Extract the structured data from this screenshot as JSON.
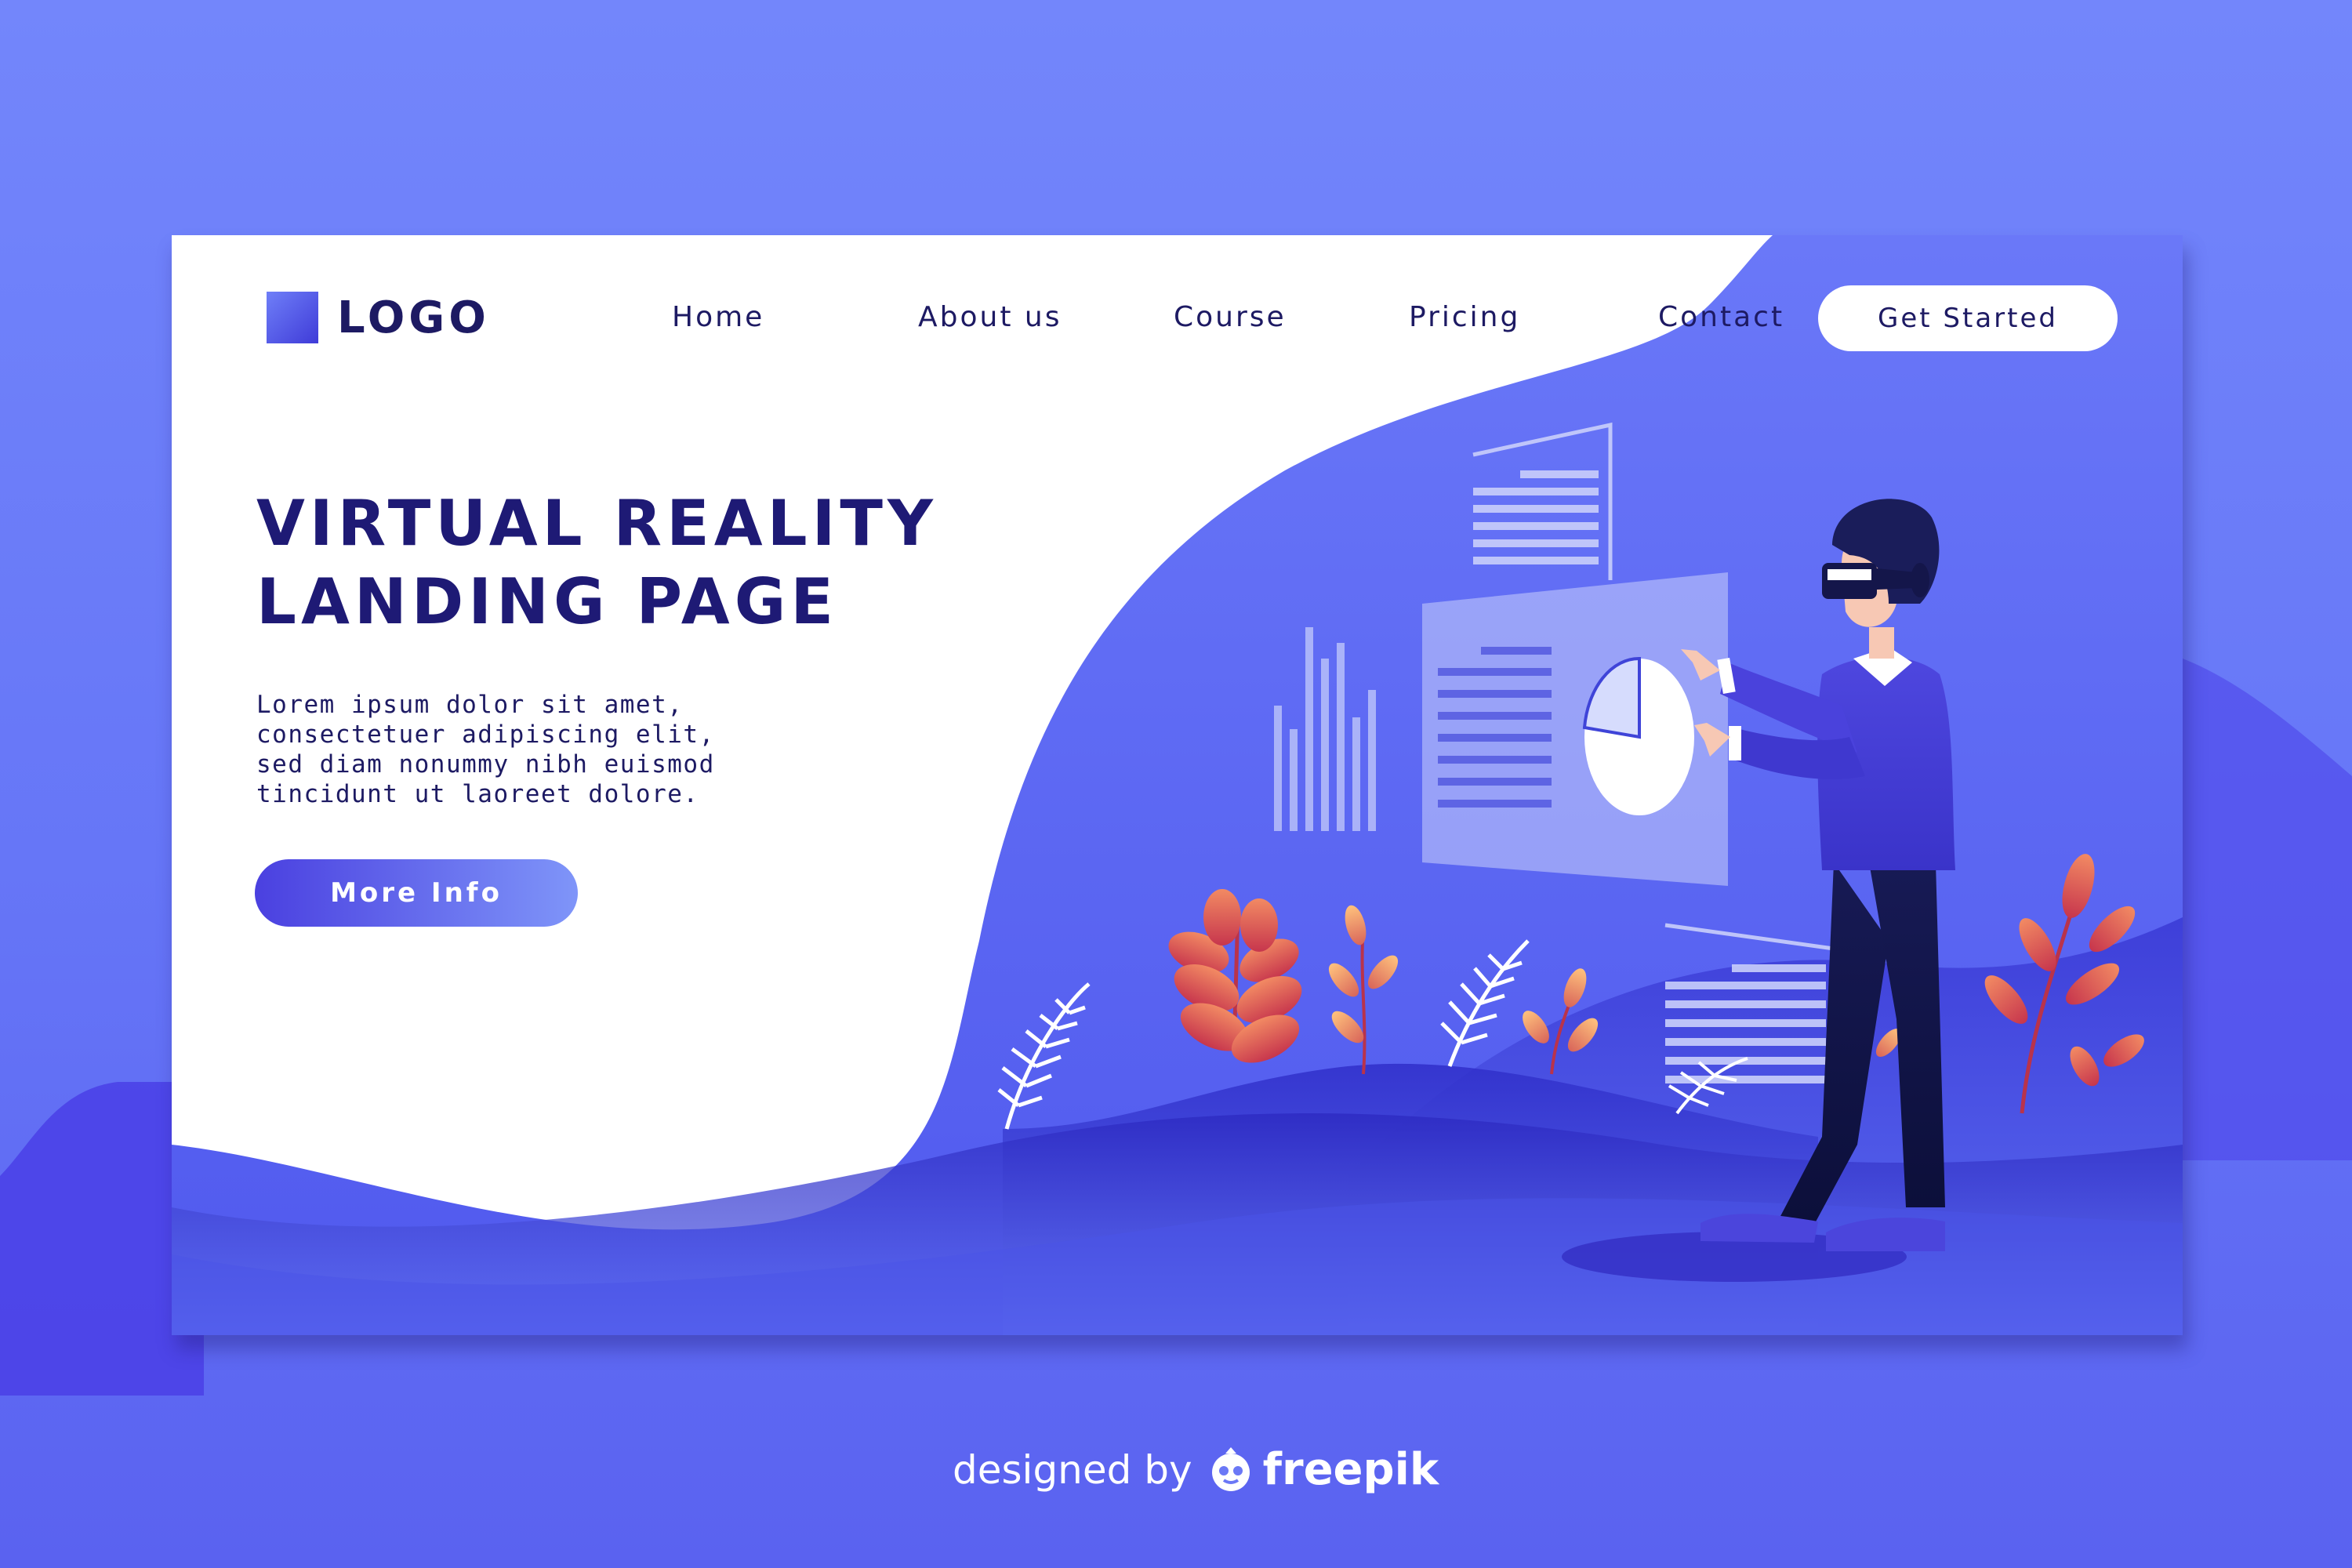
{
  "logo": {
    "text": "LOGO"
  },
  "nav": {
    "items": [
      "Home",
      "About us",
      "Course",
      "Pricing",
      "Contact"
    ],
    "cta": "Get Started"
  },
  "hero": {
    "title_line1": "VIRTUAL REALITY",
    "title_line2": "LANDING PAGE",
    "body": "Lorem ipsum dolor sit amet, consectetuer adipiscing elit, sed diam nonummy nibh euismod tincidunt ut laoreet dolore.",
    "button": "More Info"
  },
  "credit": {
    "prefix": "designed by",
    "brand": "freepik"
  },
  "colors": {
    "background": "#6676f7",
    "accent": "#4a40e0",
    "text_dark": "#1d1a63",
    "leaf_red": "#d6484e",
    "leaf_orange": "#f2a46a"
  }
}
